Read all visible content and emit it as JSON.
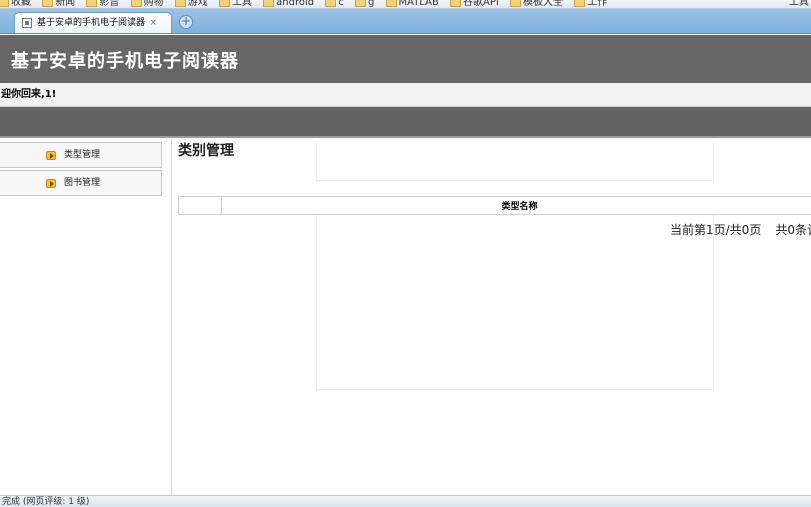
{
  "browser": {
    "bookmarks": [
      "收藏",
      "新闻",
      "影音",
      "购物",
      "游戏",
      "工具",
      "android",
      "c",
      "g",
      "MATLAB",
      "谷歌API",
      "模板大全",
      "工作"
    ],
    "bookmarks_right": "工具",
    "tab_title": "基于安卓的手机电子阅读器",
    "tab_close": "×",
    "new_tab": "+"
  },
  "header": {
    "title": "基于安卓的手机电子阅读器"
  },
  "welcome": "迎你回来,1!",
  "sidebar": {
    "items": [
      {
        "label": "类型管理"
      },
      {
        "label": "图书管理"
      }
    ]
  },
  "main": {
    "title": "类别管理",
    "table": {
      "columns": [
        "",
        "类型名称"
      ]
    },
    "pager": {
      "current": "当前第1页/共0页",
      "total": "共0条记"
    }
  },
  "status": "完成 (网页评级: 1 级)"
}
